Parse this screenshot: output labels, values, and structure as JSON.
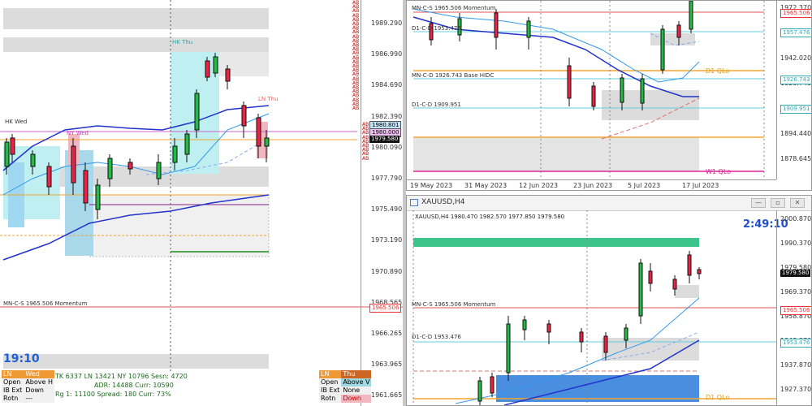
{
  "left_chart": {
    "prices": [
      "1989.290",
      "1986.990",
      "1984.690",
      "1982.390",
      "1980.090",
      "1977.790",
      "1975.490",
      "1973.190",
      "1970.890",
      "1968.565",
      "1966.265",
      "1963.965",
      "1961.665"
    ],
    "top_tags": [
      "AB",
      "AB",
      "AB",
      "AB",
      "AB",
      "AB",
      "AB",
      "AB",
      "AB",
      "AB",
      "AB",
      "AB",
      "AB",
      "AB",
      "AB",
      "AB",
      "AB",
      "AB",
      "AB",
      "AB",
      "AB",
      "AB",
      "AB",
      "AB",
      "AB",
      "AB"
    ],
    "right_tags": [
      "AB",
      "AB",
      "AB",
      "AB",
      "AB",
      "AB",
      "AB",
      "AB",
      "AB"
    ],
    "session_labels": {
      "hk_thu": "HK Thu",
      "ny_wed": "NY Wed",
      "hk_wed": "HK Wed",
      "ln_thu": "LN Thu"
    },
    "momentum_label": "MN-C-S 1965.506 Momentum",
    "price_tags": {
      "p1": "1980.801",
      "p2": "1980.000",
      "current": "1979.580",
      "momentum": "1965.506"
    },
    "clock": "19:10",
    "stats": {
      "row1": "TK 6337  LN 13421  NY 10796  Sesn: 4720",
      "row2": "ADR:    14488  Curr:   10590",
      "row3": "Rg 1: 11100  Spread: 180    Curr:  73%"
    },
    "left_table": {
      "h1": "LN",
      "h2": "Wed",
      "rows": [
        [
          "Open",
          "Above H"
        ],
        [
          "IB Ext",
          "Down"
        ],
        [
          "Rotn",
          "---"
        ]
      ]
    },
    "right_table": {
      "h1": "LN",
      "h2": "Thu",
      "rows": [
        [
          "Open",
          "Above V"
        ],
        [
          "IB Ext",
          "None"
        ],
        [
          "Rotn",
          "Down"
        ]
      ]
    }
  },
  "top_right": {
    "prices": [
      "1972.370",
      "1957.815",
      "1942.020",
      "1926.743",
      "1909.951",
      "1894.440",
      "1878.645"
    ],
    "labels": {
      "mn": "MN-C-S 1965.506 Momentum",
      "d1cd": "D1-C-D 1953.476",
      "base": "MN-C-D 1926.743 Base HIDC",
      "d1cd2": "D1-C-D 1909.951",
      "d1qlo": "D1 QLo",
      "w1qlo": "W1 QLo"
    },
    "tags": {
      "t1": "1965.506",
      "t2": "1957.476",
      "t3": "1926.743",
      "t4": "1909.951"
    },
    "dates": [
      "19 May 2023",
      "31 May 2023",
      "12 Jun 2023",
      "23 Jun 2023",
      "5 Jul 2023",
      "17 Jul 2023"
    ]
  },
  "bottom_right": {
    "title": "XAUUSD,H4",
    "info": "XAUUSD,H4  1980.470 1982.570 1977.850 1979.580",
    "timer": "2:49:10",
    "prices": [
      "2000.870",
      "1990.370",
      "1979.580",
      "1969.370",
      "1958.870",
      "1948.370",
      "1937.870",
      "1927.370"
    ],
    "labels": {
      "mn": "MN-C-S 1965.506 Momentum",
      "d1cd": "D1-C-D 1953.476",
      "d1qlo": "D1 QLo"
    },
    "tags": {
      "current": "1979.580",
      "t1": "1965.506",
      "t2": "1953.476"
    },
    "btns": [
      "—",
      "▫",
      "✕"
    ]
  }
}
